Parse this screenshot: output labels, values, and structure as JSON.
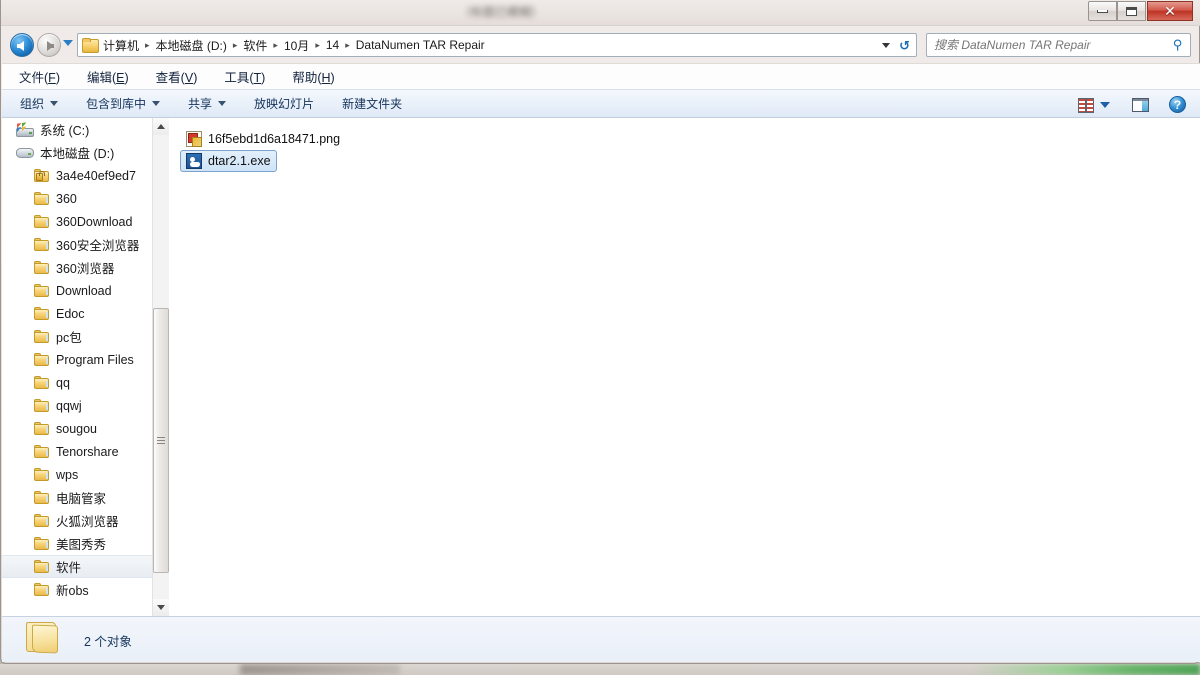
{
  "window": {
    "title_obscured": "（标题已模糊）",
    "controls": {
      "minimize": "最小化",
      "maximize": "最大化",
      "close": "✕"
    }
  },
  "address_bar": {
    "back_label": "后退",
    "forward_label": "前进",
    "history_label": "最近访问的位置",
    "folder_icon": "folder-icon",
    "breadcrumbs": [
      "计算机",
      "本地磁盘 (D:)",
      "软件",
      "10月",
      "14",
      "DataNumen TAR Repair"
    ],
    "separator": "▸",
    "dropdown_label": "▾",
    "refresh_label": "↻"
  },
  "search": {
    "placeholder": "搜索 DataNumen TAR Repair",
    "value": "",
    "icon": "search-icon"
  },
  "menu": [
    {
      "pre": "文件(",
      "key": "F",
      "post": ")"
    },
    {
      "pre": "编辑(",
      "key": "E",
      "post": ")"
    },
    {
      "pre": "查看(",
      "key": "V",
      "post": ")"
    },
    {
      "pre": "工具(",
      "key": "T",
      "post": ")"
    },
    {
      "pre": "帮助(",
      "key": "H",
      "post": ")"
    }
  ],
  "command_bar": {
    "buttons": [
      {
        "label": "组织",
        "has_caret": true
      },
      {
        "label": "包含到库中",
        "has_caret": true
      },
      {
        "label": "共享",
        "has_caret": true
      },
      {
        "label": "放映幻灯片",
        "has_caret": false
      },
      {
        "label": "新建文件夹",
        "has_caret": false
      }
    ],
    "right_icons": {
      "views": "view-options-icon",
      "views_caret": "chevron-down-icon",
      "preview_pane": "preview-pane-icon",
      "help": "?"
    }
  },
  "nav_pane": {
    "items": [
      {
        "label": "系统 (C:)",
        "icon": "system-drive-icon",
        "indent": 0,
        "selected": false
      },
      {
        "label": "本地磁盘 (D:)",
        "icon": "drive-icon",
        "indent": 0,
        "selected": false
      },
      {
        "label": "3a4e40ef9ed7",
        "icon": "locked-folder-icon",
        "indent": 1,
        "selected": false
      },
      {
        "label": "360",
        "icon": "folder-icon",
        "indent": 1,
        "selected": false
      },
      {
        "label": "360Download",
        "icon": "folder-icon",
        "indent": 1,
        "selected": false
      },
      {
        "label": "360安全浏览器",
        "icon": "folder-icon",
        "indent": 1,
        "selected": false
      },
      {
        "label": "360浏览器",
        "icon": "folder-icon",
        "indent": 1,
        "selected": false
      },
      {
        "label": "Download",
        "icon": "folder-icon",
        "indent": 1,
        "selected": false
      },
      {
        "label": "Edoc",
        "icon": "folder-icon",
        "indent": 1,
        "selected": false
      },
      {
        "label": "pc包",
        "icon": "folder-icon",
        "indent": 1,
        "selected": false
      },
      {
        "label": "Program Files",
        "icon": "folder-icon",
        "indent": 1,
        "selected": false
      },
      {
        "label": "qq",
        "icon": "folder-icon",
        "indent": 1,
        "selected": false
      },
      {
        "label": "qqwj",
        "icon": "folder-icon",
        "indent": 1,
        "selected": false
      },
      {
        "label": "sougou",
        "icon": "folder-icon",
        "indent": 1,
        "selected": false
      },
      {
        "label": "Tenorshare",
        "icon": "folder-icon",
        "indent": 1,
        "selected": false
      },
      {
        "label": "wps",
        "icon": "folder-icon",
        "indent": 1,
        "selected": false
      },
      {
        "label": "电脑管家",
        "icon": "folder-icon",
        "indent": 1,
        "selected": false
      },
      {
        "label": "火狐浏览器",
        "icon": "folder-icon",
        "indent": 1,
        "selected": false
      },
      {
        "label": "美图秀秀",
        "icon": "folder-icon",
        "indent": 1,
        "selected": false
      },
      {
        "label": "软件",
        "icon": "folder-icon",
        "indent": 1,
        "selected": true
      },
      {
        "label": "新obs",
        "icon": "folder-icon",
        "indent": 1,
        "selected": false
      }
    ],
    "scrollbar": {
      "up": "▲",
      "down": "▼"
    }
  },
  "files": [
    {
      "name": "16f5ebd1d6a18471.png",
      "icon": "image-file-icon",
      "selected": false
    },
    {
      "name": "dtar2.1.exe",
      "icon": "application-file-icon",
      "selected": true
    }
  ],
  "status_bar": {
    "icon": "folder-icon",
    "text": "2 个对象"
  },
  "colors": {
    "accent_blue": "#1a6db5",
    "selection_fill": "#cfe4f8",
    "selection_border": "#7da2ce",
    "close_button_red": "#bd3425",
    "command_bar_bg": "#eaf1fa"
  }
}
